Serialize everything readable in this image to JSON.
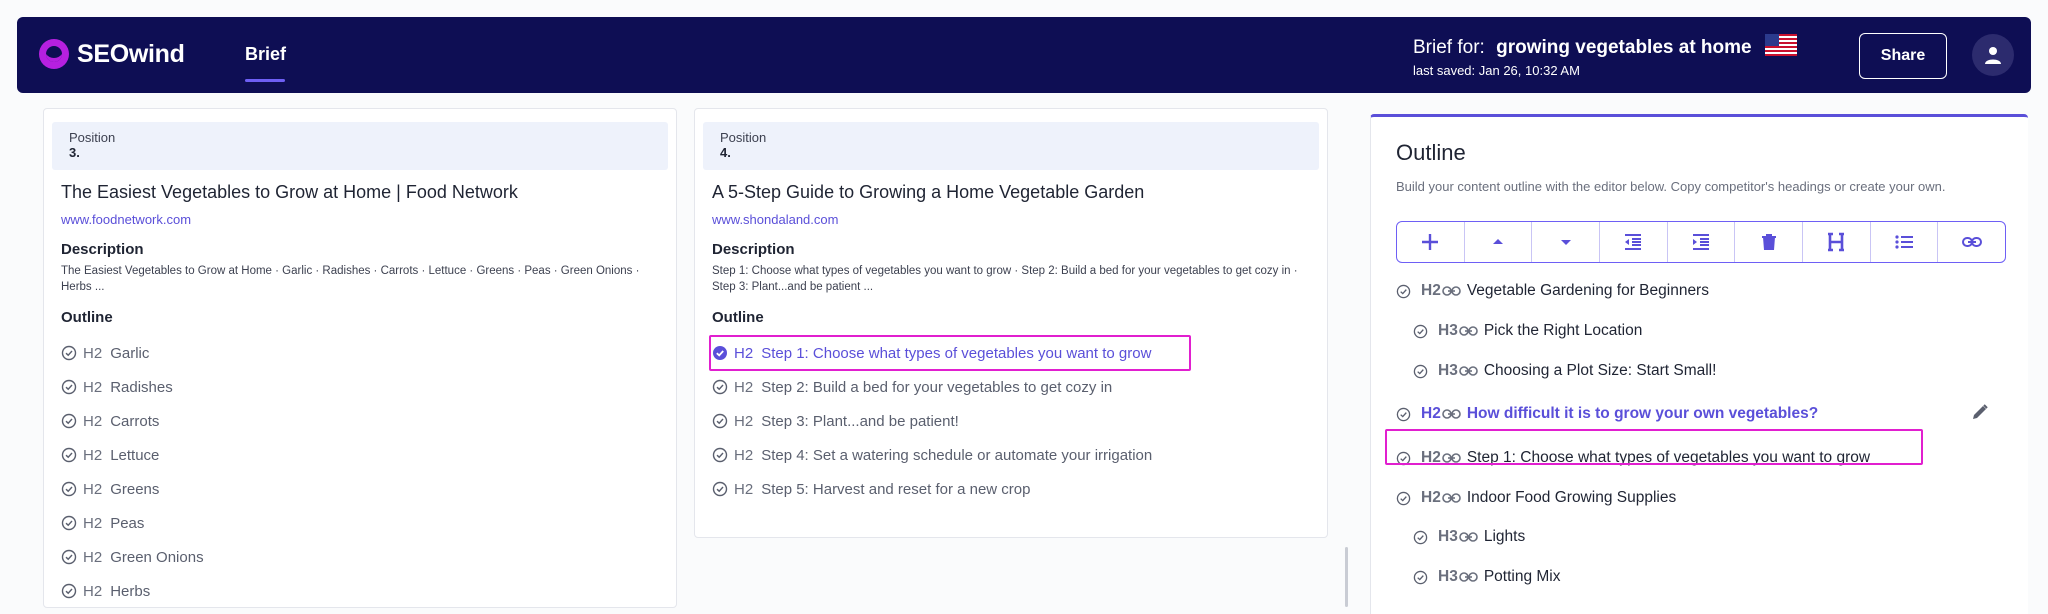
{
  "header": {
    "logo_text": "SEOwind",
    "nav_tab": "Brief",
    "brief_label": "Brief for:",
    "brief_topic": "growing vegetables at home",
    "last_saved": "last saved: Jan 26, 10:32 AM",
    "share_label": "Share",
    "colors": {
      "bar": "#0e0e54",
      "accent": "#6e5ff5"
    }
  },
  "results": [
    {
      "position_label": "Position",
      "position_num": "3.",
      "title": "The Easiest Vegetables to Grow at Home | Food Network",
      "url": "www.foodnetwork.com",
      "description_heading": "Description",
      "description": "The Easiest Vegetables to Grow at Home · Garlic · Radishes · Carrots · Lettuce · Greens · Peas · Green Onions · Herbs ...",
      "outline_heading": "Outline",
      "outline": [
        {
          "tag": "H2",
          "text": "Garlic"
        },
        {
          "tag": "H2",
          "text": "Radishes"
        },
        {
          "tag": "H2",
          "text": "Carrots"
        },
        {
          "tag": "H2",
          "text": "Lettuce"
        },
        {
          "tag": "H2",
          "text": "Greens"
        },
        {
          "tag": "H2",
          "text": "Peas"
        },
        {
          "tag": "H2",
          "text": "Green Onions"
        },
        {
          "tag": "H2",
          "text": "Herbs"
        }
      ]
    },
    {
      "position_label": "Position",
      "position_num": "4.",
      "title": "A 5-Step Guide to Growing a Home Vegetable Garden",
      "url": "www.shondaland.com",
      "description_heading": "Description",
      "description": "Step 1: Choose what types of vegetables you want to grow · Step 2: Build a bed for your vegetables to get cozy in · Step 3: Plant...and be patient ...",
      "outline_heading": "Outline",
      "outline": [
        {
          "tag": "H2",
          "text": "Step 1: Choose what types of vegetables you want to grow",
          "active": true
        },
        {
          "tag": "H2",
          "text": "Step 2: Build a bed for your vegetables to get cozy in"
        },
        {
          "tag": "H2",
          "text": "Step 3: Plant...and be patient!"
        },
        {
          "tag": "H2",
          "text": "Step 4: Set a watering schedule or automate your irrigation"
        },
        {
          "tag": "H2",
          "text": "Step 5: Harvest and reset for a new crop"
        }
      ]
    }
  ],
  "outline_panel": {
    "title": "Outline",
    "subtitle": "Build your content outline with the editor below. Copy competitor's headings or create your own.",
    "toolbar": [
      "plus-icon",
      "move-up-icon",
      "move-down-icon",
      "outdent-icon",
      "indent-icon",
      "trash-icon",
      "heading-icon",
      "list-icon",
      "link-icon"
    ],
    "items": [
      {
        "tag": "H2",
        "text": "Vegetable Gardening for Beginners"
      },
      {
        "tag": "H3",
        "text": "Pick the Right Location"
      },
      {
        "tag": "H3",
        "text": "Choosing a Plot Size: Start Small!"
      },
      {
        "tag": "H2",
        "text": "How difficult it is to grow your own vegetables?",
        "active": true
      },
      {
        "tag": "H2",
        "text": "Step 1: Choose what types of vegetables you want to grow",
        "highlighted": true
      },
      {
        "tag": "H2",
        "text": "Indoor Food Growing Supplies"
      },
      {
        "tag": "H3",
        "text": "Lights"
      },
      {
        "tag": "H3",
        "text": "Potting Mix"
      }
    ]
  }
}
